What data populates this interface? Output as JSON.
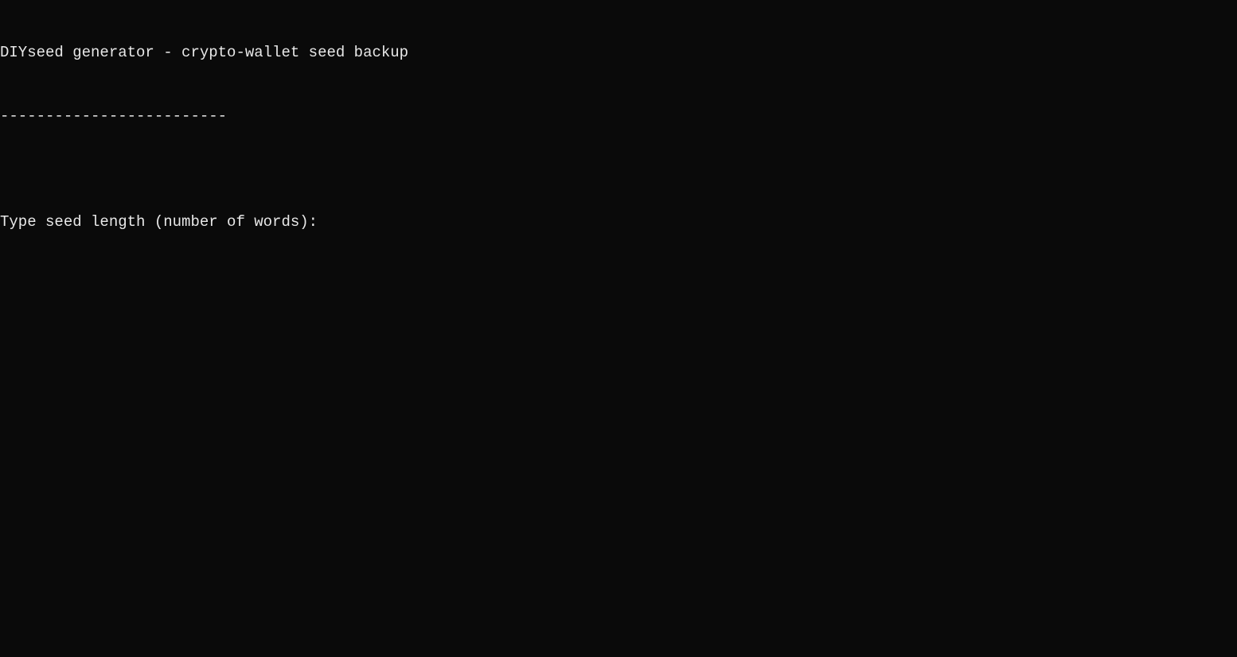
{
  "terminal": {
    "title_line": "DIYseed generator - crypto-wallet seed backup",
    "separator": "-------------------------",
    "blank": "",
    "prompt": "Type seed length (number of words):",
    "input_value": ""
  }
}
